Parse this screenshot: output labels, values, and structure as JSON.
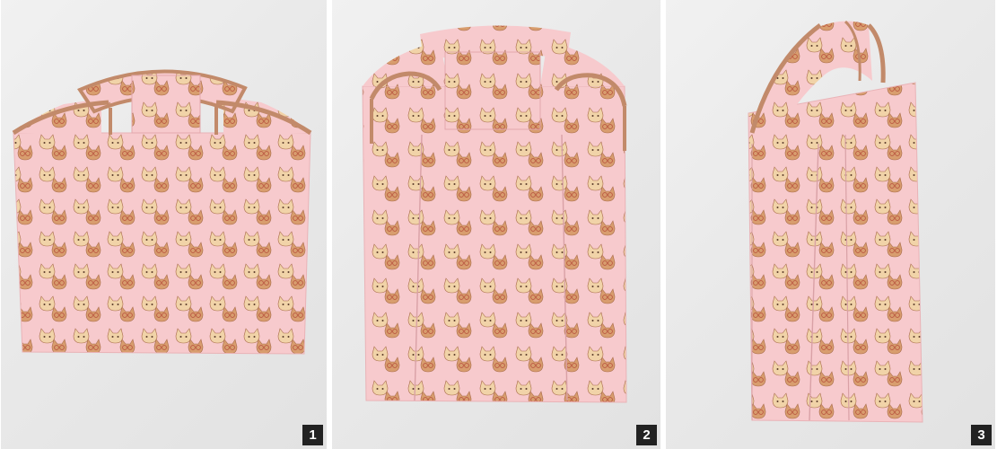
{
  "steps": [
    {
      "number": "1"
    },
    {
      "number": "2"
    },
    {
      "number": "3"
    }
  ],
  "colors": {
    "background": "#ececec",
    "fabric": "#f6c9cc",
    "trim": "#c28a6a",
    "cat_face": "#f0d2a6",
    "cat_dark": "#c98d62",
    "glasses": "#b8543f",
    "badge": "#222222"
  }
}
